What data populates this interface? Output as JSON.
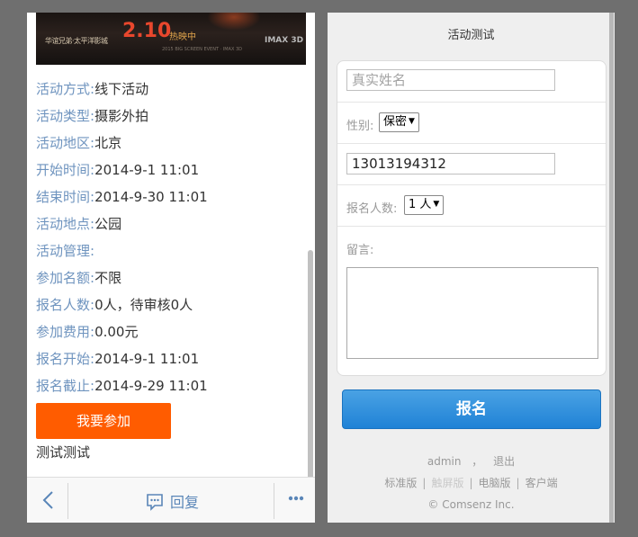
{
  "left": {
    "banner": {
      "left_text": "华谊兄弟·太平洋影城",
      "date_text": "2.10",
      "sub_text": "热映中",
      "imax_text": "IMAX 3D",
      "small_text": "2015 BIG SCREEN EVENT · IMAX 3D"
    },
    "info_rows": [
      {
        "key": "活动方式:",
        "value": "线下活动"
      },
      {
        "key": "活动类型:",
        "value": "摄影外拍"
      },
      {
        "key": "活动地区:",
        "value": "北京"
      },
      {
        "key": "开始时间:",
        "value": "2014-9-1 11:01"
      },
      {
        "key": "结束时间:",
        "value": "2014-9-30 11:01"
      },
      {
        "key": "活动地点:",
        "value": "公园"
      },
      {
        "key": "活动管理:",
        "value": ""
      },
      {
        "key": "参加名额:",
        "value": "不限"
      },
      {
        "key": "报名人数:",
        "value": "0人，待审核0人"
      },
      {
        "key": "参加费用:",
        "value": "0.00元"
      },
      {
        "key": "报名开始:",
        "value": "2014-9-1 11:01"
      },
      {
        "key": "报名截止:",
        "value": "2014-9-29 11:01"
      }
    ],
    "join_button": "我要参加",
    "description": "测试测试",
    "bottom_bar": {
      "back_icon": "chevron-left-icon",
      "reply_label": "回复",
      "reply_icon": "chat-bubble-icon",
      "more_icon": "ellipsis-icon"
    }
  },
  "right": {
    "title": "活动测试",
    "form": {
      "name_placeholder": "真实姓名",
      "gender_label": "性别:",
      "gender_selected": "保密",
      "phone_value": "13013194312",
      "count_label": "报名人数:",
      "count_selected": "1 人",
      "message_label": "留言:"
    },
    "submit_button": "报名",
    "footer": {
      "user": "admin",
      "comma": "，",
      "logout": "退出",
      "links": [
        "标准版",
        "触屏版",
        "电脑版",
        "客户端"
      ],
      "copyright": "© Comsenz Inc."
    }
  },
  "colors": {
    "accent_orange": "#ff5c00",
    "link_blue": "#6f94bf",
    "button_blue": "#2a8ddc"
  }
}
